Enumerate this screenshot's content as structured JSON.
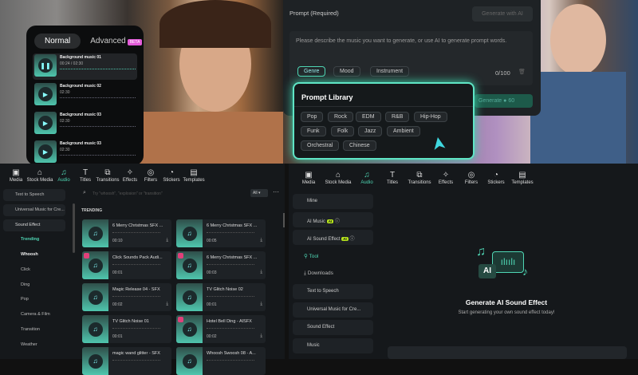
{
  "phone": {
    "tab_normal": "Normal",
    "tab_advanced": "Advanced",
    "beta": "BETA",
    "items": [
      {
        "title": "Background music 01",
        "time": "00:24 / 02:30"
      },
      {
        "title": "Background music 02",
        "time": "02:30"
      },
      {
        "title": "Background music 03",
        "time": "02:30"
      },
      {
        "title": "Background music 03",
        "time": "02:30"
      }
    ]
  },
  "prompt": {
    "label": "Prompt (Required)",
    "generate_ai": "Generate with AI",
    "placeholder": "Please describe the music you want to generate, or use AI to generate prompt words.",
    "chips": [
      "Genre",
      "Mood",
      "Instrument"
    ],
    "counter": "0/100",
    "generate": "Generate",
    "credits": "60"
  },
  "library": {
    "title": "Prompt Library",
    "tags": [
      "Pop",
      "Rock",
      "EDM",
      "R&B",
      "Hip-Hop",
      "Funk",
      "Folk",
      "Jazz",
      "Ambient",
      "Orchestral",
      "Chinese"
    ]
  },
  "toolbar": [
    "Media",
    "Stock Media",
    "Audio",
    "Titles",
    "Transitions",
    "Effects",
    "Filters",
    "Stickers",
    "Templates"
  ],
  "left": {
    "sidebar": [
      "Text to Speech",
      "Universal Music for Cre...",
      "Sound Effect"
    ],
    "sub": [
      "Trending",
      "Whoosh",
      "Click",
      "Ding",
      "Pop",
      "Camera & Film",
      "Transition",
      "Weather"
    ],
    "search_placeholder": "Try \"whoosh\", \"explosion\" or \"transition\"",
    "filter": "All",
    "section": "TRENDING",
    "cards": [
      {
        "title": "6 Merry Christmas SFX ...",
        "time": "00:10"
      },
      {
        "title": "6 Merry Christmas SFX ...",
        "time": "00:05"
      },
      {
        "title": "Click Sounds Pack Audi...",
        "time": "00:01"
      },
      {
        "title": "6 Merry Christmas SFX ...",
        "time": "00:03"
      },
      {
        "title": "Magic Release 04 - SFX",
        "time": "00:02"
      },
      {
        "title": "TV Glitch Noise 02",
        "time": "00:01"
      },
      {
        "title": "TV Glitch Noise 01",
        "time": "00:01"
      },
      {
        "title": "Hotel Bell Ding - AISFX",
        "time": "00:02"
      },
      {
        "title": "magic wand glitter - SFX",
        "time": ""
      },
      {
        "title": "Whoosh Swoosh 08 - A...",
        "time": ""
      }
    ]
  },
  "right": {
    "sidebar": [
      "Mine",
      "AI Music",
      "AI Sound Effect",
      "Tool",
      "Downloads",
      "Text to Speech",
      "Universal Music for Cre...",
      "Sound Effect",
      "Music"
    ],
    "ai_badge": "AI",
    "title": "Generate AI Sound Effect",
    "subtitle": "Start generating your own sound effect today!",
    "art_label": "AI"
  },
  "colors": {
    "accent": "#4fd6b4",
    "ai_badge": "#b6e41c"
  }
}
